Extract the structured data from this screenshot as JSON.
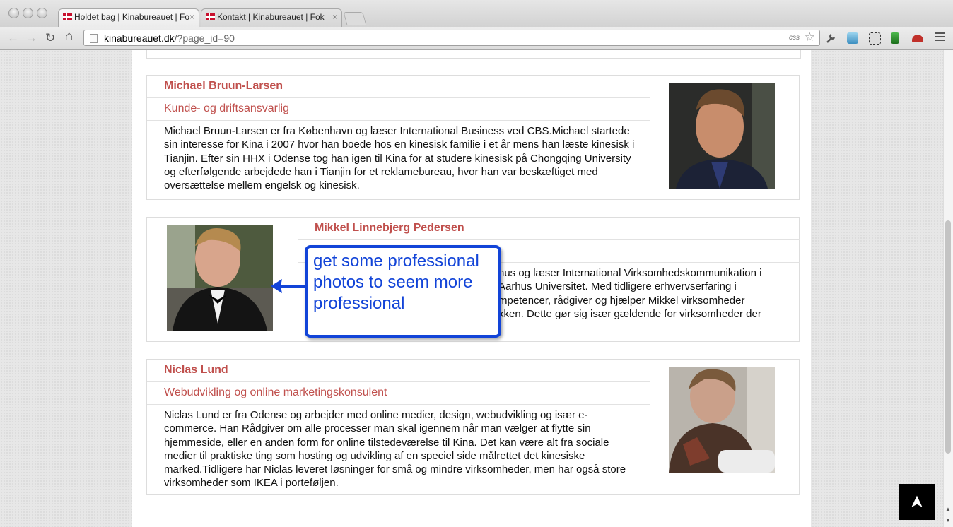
{
  "browser": {
    "tabs": [
      {
        "title": "Holdet bag | Kinabureauet | Fo",
        "close": "×"
      },
      {
        "title": "Kontakt | Kinabureauet | Fok",
        "close": "×"
      }
    ],
    "url_host": "kinabureauet.dk",
    "url_path": "/?page_id=90",
    "css_badge": "css",
    "back": "←",
    "forward": "→",
    "reload": "↻",
    "home": "⌂",
    "star": "☆"
  },
  "team": [
    {
      "name": "Michael Bruun-Larsen",
      "role": "Kunde- og driftsansvarlig",
      "bio": "Michael Bruun-Larsen er fra København og læser International Business ved CBS.Michael startede sin interesse for Kina i 2007 hvor han boede hos en kinesisk familie i et år mens han læste kinesisk i Tianjin. Efter sin HHX i Odense tog han igen til Kina for at studere kinesisk på Chongqing University og efterfølgende arbejdede han i Tianjin for et reklamebureau, hvor han var beskæftiget med oversættelse mellem engelsk og kinesisk."
    },
    {
      "name": "Mikkel Linnebjerg Pedersen",
      "role": "",
      "bio_lines": [
        "hus og læser International Virksomhedskommunikation i",
        "Aarhus Universitet. Med tidligere erhvervserfaring i",
        "mpetencer, rådgiver og hjælper Mikkel virksomheder",
        "kken. Dette gør sig især gældende for virksomheder der"
      ]
    },
    {
      "name": "Niclas Lund",
      "role": "Webudvikling og online marketingskonsulent",
      "bio": "Niclas Lund er fra Odense og arbejder med online medier, design, webudvikling og især e-commerce. Han Rådgiver om alle processer man skal igennem når man vælger at flytte sin hjemmeside, eller en anden form for online tilstedeværelse til Kina. Det kan være alt fra sociale medier til praktiske ting som hosting og udvikling af en speciel side målrettet det kinesiske marked.Tidligere har Niclas leveret løsninger for små og mindre virksomheder, men har også store virksomheder som IKEA i porteføljen."
    }
  ],
  "annotation": {
    "text": "get some professional photos to seem more professional"
  },
  "back_to_top": "➤",
  "colors": {
    "accent": "#c0504d",
    "annotation": "#1244d8"
  }
}
